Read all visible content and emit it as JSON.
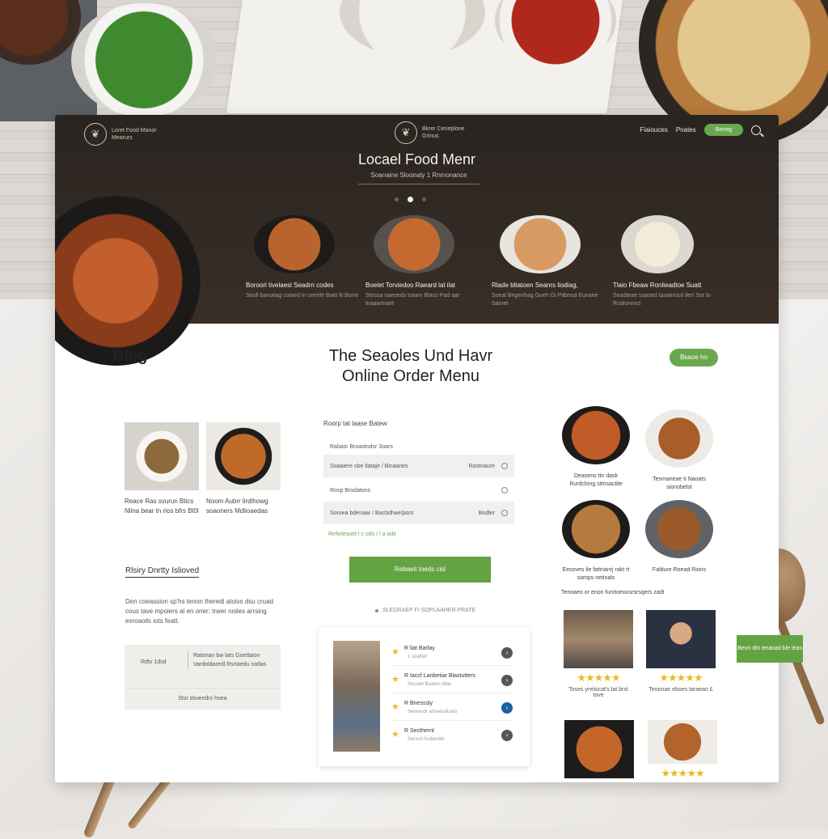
{
  "hero": {
    "logo_left_text": "Loret Food Manor Mearurs",
    "logo_center_text": "Bkrer Ceneplone Grinus",
    "nav": [
      "Fiaiouces",
      "Pnates"
    ],
    "nav_button": "Boneg",
    "title": "Locael Food Menr",
    "subtitle": "Soanaine Sloonaty 1 Rnmonance",
    "items": [
      {
        "name": "Boroorl tivelaesl Seadrn codes",
        "desc": "Seoll banotiag colaed ln ceerile Baet lit Borre"
      },
      {
        "name": "Boelet Torviedoo Raeard lat ilat",
        "desc": "Stessa naeoeds traarn Blaco Pad aar lnaaartnaet"
      },
      {
        "name": "Rlade bltatoen Seanrs liodiag,",
        "desc": "Soeal Brigenhag Goeh Gi Pitbnod Eunaee Sarnet"
      },
      {
        "name": "Tlaio Fbeaw Ronlieadtoe Suatt",
        "desc": "Seadteae soaoed lasaerocd ilert Sor lu Rodronmct"
      }
    ]
  },
  "blog": {
    "title": "Blog",
    "cards": [
      {
        "caption": "Reace Ras svurun Btics Nlina bear tn rios bfrs Bl0l"
      },
      {
        "caption": "Noom Aubrr lirdlhowg soaoners Mdlioaedas"
      }
    ],
    "story_head": "Rlsiry Dnrtty Islioved",
    "story_text": "Den coeassion sp'hs tenon theredi atoivs dsu cruad cous tave mpoiers al en oner: trwer noiies arrsing exroaoils iots featt.",
    "box_left": "Rdtv 1dsd",
    "box_right": "Ratonan bw lats Goettaion Vardoldaredl Rsrtaedu natlas",
    "box_bottom": "Stsr dsvendrs hoea"
  },
  "main": {
    "title_line1": "The Seaoles Und Havr",
    "title_line2": "Online Order Menu",
    "cta": "Bsaoe ho"
  },
  "order": {
    "label": "Roorp tat laase Batew",
    "fields": [
      {
        "left": "Rabasr Broastndsr 3oars",
        "right": ""
      },
      {
        "left": "Soaaiere sbe tlataje / Bicaanes",
        "right": "Rastnaure"
      },
      {
        "left": "Rosp Brodatons",
        "right": ""
      },
      {
        "left": "Soroea bdenaar / Bacbdhae/pont",
        "right": "Bodler"
      }
    ],
    "note": "Refeilesoet l c ods / l a ode",
    "button": "Rebaeit toeds cisl",
    "status": "SLEGRAEP FI SOPLAAHER PRATE"
  },
  "reviews": [
    {
      "name": "R liat Barlay",
      "sub": "1 soaltiet",
      "go": "›"
    },
    {
      "name": "R taccf Lanbetiar Blastutters",
      "sub": "Sesalet Baaton dtde",
      "go": "›"
    },
    {
      "name": "R Bnesssly",
      "sub": "Sereandr ansaesdioais",
      "go": "›"
    },
    {
      "name": "R Secthernt",
      "sub": "Sarsorl fsoberdel",
      "go": "›"
    }
  ],
  "dishes": [
    {
      "caption": "Deasens ttn dask Rurdclong sttnsactite"
    },
    {
      "caption": "Tesmaneae ti Naoats sionobelst"
    },
    {
      "caption": "Eesoves ile fattnanrj rakt rt somps netinals"
    },
    {
      "caption": "Faldure Roead Rions"
    }
  ],
  "testimonials": {
    "heading": "Tenoaeo or enon furvtoeoosrsrsqers zadt",
    "items": [
      {
        "caption": "Toses yrelsicat's lat brst tove",
        "stars": "★★★★★"
      },
      {
        "caption": "Teoonae eboes taraean £",
        "stars": "★★★★★"
      },
      {
        "caption": "",
        "stars": ""
      },
      {
        "caption": "",
        "stars": "★★★★★"
      }
    ]
  },
  "side_tag": "Beon dtn teraoad ble leas",
  "colors": {
    "accent": "#64a342",
    "hero_bg": "#2a2420",
    "star": "#e8b923"
  }
}
